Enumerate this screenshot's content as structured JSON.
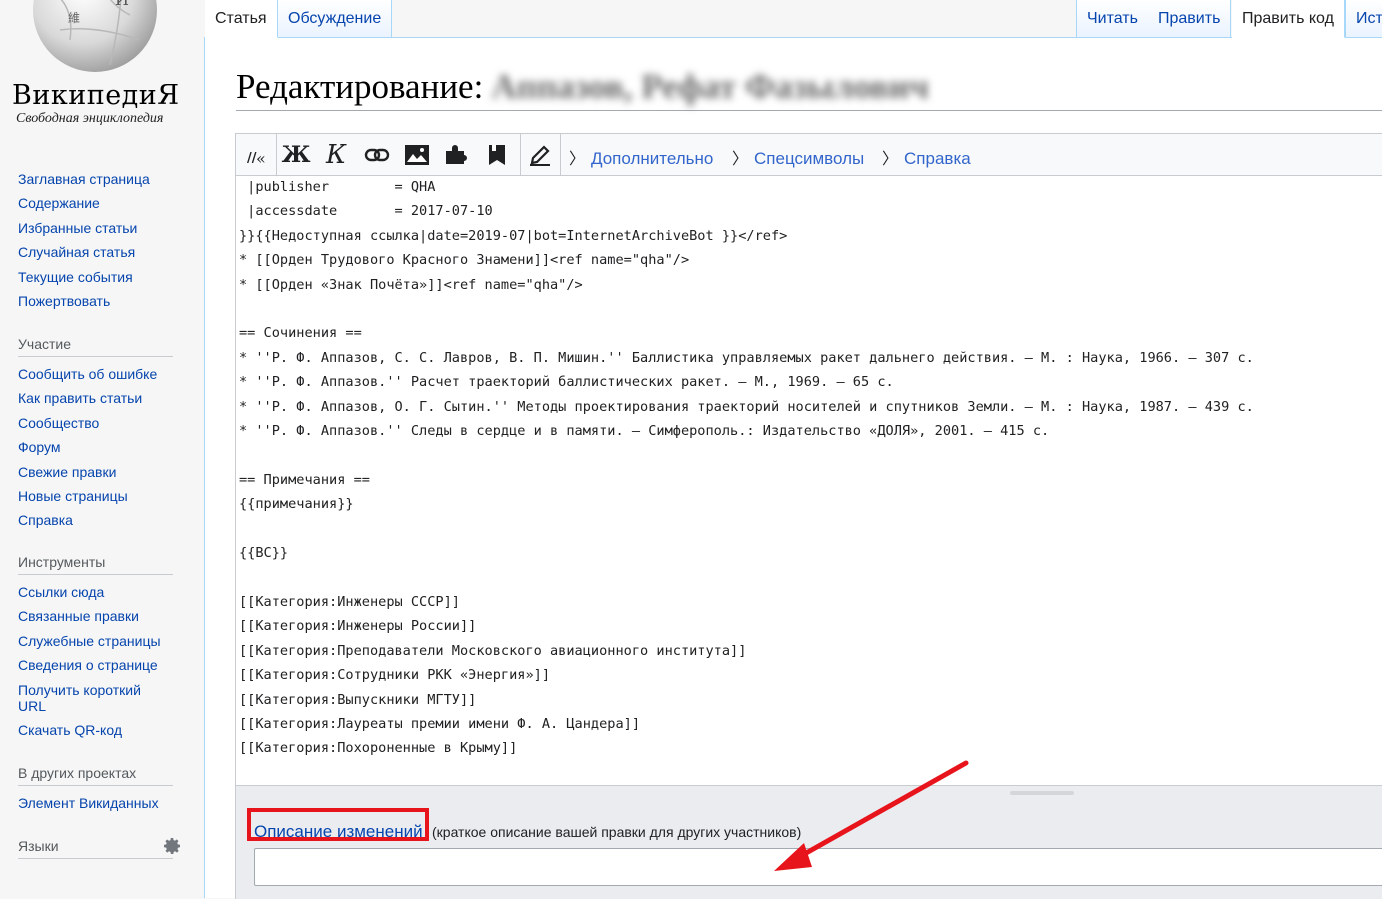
{
  "logo": {
    "wordmark": "ВикипедиЯ",
    "tagline": "Свободная энциклопедия"
  },
  "sidebar": {
    "navigation": [
      "Заглавная страница",
      "Содержание",
      "Избранные статьи",
      "Случайная статья",
      "Текущие события",
      "Пожертвовать"
    ],
    "participation": {
      "heading": "Участие",
      "items": [
        "Сообщить об ошибке",
        "Как править статьи",
        "Сообщество",
        "Форум",
        "Свежие правки",
        "Новые страницы",
        "Справка"
      ]
    },
    "tools": {
      "heading": "Инструменты",
      "items": [
        "Ссылки сюда",
        "Связанные правки",
        "Служебные страницы",
        "Сведения о странице",
        "Получить короткий URL",
        "Скачать QR-код"
      ]
    },
    "projects": {
      "heading": "В других проектах",
      "items": [
        "Элемент Викиданных"
      ]
    },
    "languages": {
      "heading": "Языки"
    }
  },
  "tabs": {
    "left": [
      "Статья",
      "Обсуждение"
    ],
    "right": [
      "Читать",
      "Править",
      "Править код",
      "Ист"
    ],
    "selected_left": "Статья",
    "selected_right": "Править код"
  },
  "heading": {
    "prefix": "Редактирование:",
    "blurred_title": "Аппазов, Рефат Фазылович"
  },
  "toolbar": {
    "buttons": [
      "wikimarkup-icon",
      "bold-icon",
      "italic-icon",
      "link-icon",
      "image-icon",
      "template-icon",
      "reference-icon",
      "signature-icon"
    ],
    "bold_label": "Ж",
    "italic_label": "К",
    "links": [
      "Дополнительно",
      "Спецсимволы",
      "Справка"
    ]
  },
  "editor": {
    "lines": [
      " |publisher        = QHA",
      " |accessdate       = 2017-07-10",
      "}}{{Недоступная ссылка|date=2019-07|bot=InternetArchiveBot }}</ref>",
      "* [[Орден Трудового Красного Знамени]]<ref name=\"qha\"/>",
      "* [[Орден «Знак Почёта»]]<ref name=\"qha\"/>",
      "",
      "== Сочинения ==",
      "* ''Р. Ф. Аппазов, С. С. Лавров, В. П. Мишин.'' Баллистика управляемых ракет дальнего действия. — М. : Наука, 1966. — 307 с.",
      "* ''Р. Ф. Аппазов.'' Расчет траекторий баллистических ракет. — М., 1969. — 65 с.",
      "* ''Р. Ф. Аппазов, О. Г. Сытин.'' Методы проектирования траекторий носителей и спутников Земли. — М. : Наука, 1987. — 439 с.",
      "* ''Р. Ф. Аппазов.'' Следы в сердце и в памяти. — Симферополь.: Издательство «ДОЛЯ», 2001. — 415 с.",
      "",
      "== Примечания ==",
      "{{примечания}}",
      "",
      "{{ВС}}",
      "",
      "[[Категория:Инженеры СССР]]",
      "[[Категория:Инженеры России]]",
      "[[Категория:Преподаватели Московского авиационного института]]",
      "[[Категория:Сотрудники РКК «Энергия»]]",
      "[[Категория:Выпускники МГТУ]]",
      "[[Категория:Лауреаты премии имени Ф. А. Цандера]]",
      "[[Категория:Похороненные в Крыму]]"
    ]
  },
  "summary": {
    "label": "Описание изменений",
    "hint": "(краткое описание вашей правки для других участников)",
    "value": ""
  },
  "colors": {
    "link": "#0645ad",
    "annotation_red": "#e8141b",
    "tab_border": "#a7d7f9"
  }
}
